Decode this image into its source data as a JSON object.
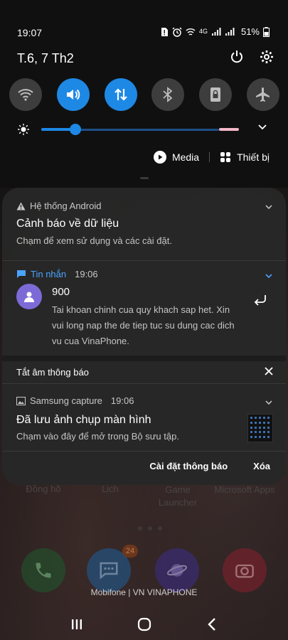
{
  "status_bar": {
    "time": "19:07",
    "network": "4G",
    "battery": "51%"
  },
  "quick_panel": {
    "date": "T.6, 7 Th2",
    "tiles": [
      {
        "name": "wifi-icon",
        "on": false
      },
      {
        "name": "sound-icon",
        "on": true
      },
      {
        "name": "mobile-data-icon",
        "on": true
      },
      {
        "name": "bluetooth-icon",
        "on": false
      },
      {
        "name": "portrait-lock-icon",
        "on": false
      },
      {
        "name": "airplane-icon",
        "on": false
      }
    ],
    "brightness_level": 0.19,
    "media_label": "Media",
    "devices_label": "Thiết bị"
  },
  "notifications": {
    "android": {
      "app": "Hệ thống Android",
      "title": "Cảnh báo về dữ liệu",
      "body": "Chạm để xem sử dụng và các cài đặt."
    },
    "messages": {
      "app": "Tin nhắn",
      "time": "19:06",
      "sender": "900",
      "body": "Tai khoan chinh cua quy khach sap het. Xin vui long nap the de tiep tuc su dung cac dich vu cua VinaPhone."
    },
    "mute_label": "Tắt âm thông báo",
    "capture": {
      "app": "Samsung capture",
      "time": "19:06",
      "title": "Đã lưu ảnh chụp màn hình",
      "body": "Chạm vào đây để mở trong Bộ sưu tập."
    },
    "settings_label": "Cài đặt thông báo",
    "clear_label": "Xóa"
  },
  "home": {
    "app_labels": [
      "Đồng hồ",
      "Lịch",
      "Game Launcher",
      "Microsoft Apps"
    ],
    "badge": "24",
    "carrier": "Mobifone | VN VINAPHONE"
  },
  "colors": {
    "accent": "#1e88e5",
    "tile_off": "#3d3d3d",
    "avatar": "#7c6bd6"
  }
}
